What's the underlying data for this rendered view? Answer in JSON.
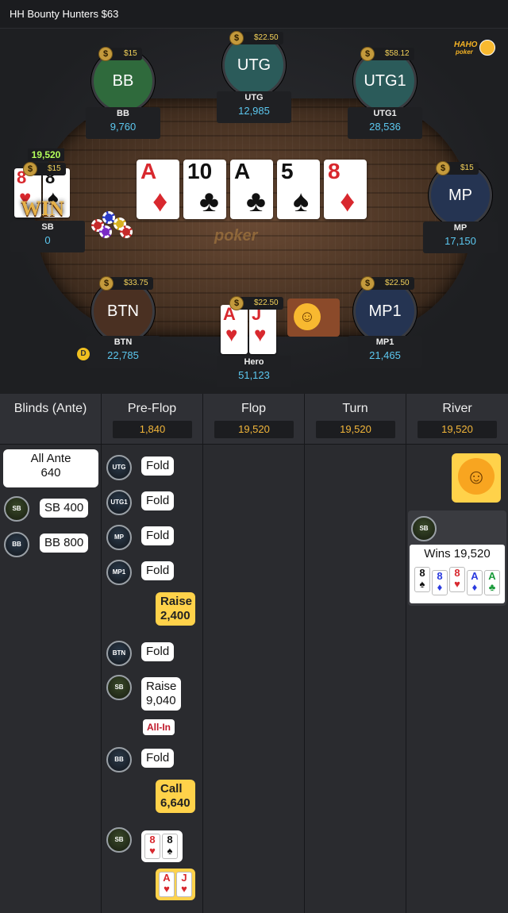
{
  "header": {
    "title": "HH  Bounty Hunters $63"
  },
  "brand": {
    "line1": "HAHO",
    "line2": "poker"
  },
  "table": {
    "watermark": "poker",
    "pot": "19,520",
    "win_label": "WIN"
  },
  "board": [
    {
      "rank": "A",
      "suit": "♦",
      "color": "red"
    },
    {
      "rank": "10",
      "suit": "♣",
      "color": "black"
    },
    {
      "rank": "A",
      "suit": "♣",
      "color": "black"
    },
    {
      "rank": "5",
      "suit": "♠",
      "color": "black"
    },
    {
      "rank": "8",
      "suit": "♦",
      "color": "red"
    }
  ],
  "seats": {
    "bb": {
      "pos": "BB",
      "name": "BB",
      "stack": "9,760",
      "bounty": "$15",
      "color": "#2f6a3c"
    },
    "utg": {
      "pos": "UTG",
      "name": "UTG",
      "stack": "12,985",
      "bounty": "$22.50",
      "color": "#2b5b5a"
    },
    "utg1": {
      "pos": "UTG1",
      "name": "UTG1",
      "stack": "28,536",
      "bounty": "$58.12",
      "color": "#2b5b5a"
    },
    "sb": {
      "name": "SB",
      "stack": "0",
      "bounty": "$15",
      "cards": [
        {
          "rank": "8",
          "suit": "♥",
          "color": "red"
        },
        {
          "rank": "8",
          "suit": "♠",
          "color": "black"
        }
      ]
    },
    "mp": {
      "pos": "MP",
      "name": "MP",
      "stack": "17,150",
      "bounty": "$15",
      "color": "#253452"
    },
    "btn": {
      "pos": "BTN",
      "name": "BTN",
      "stack": "22,785",
      "bounty": "$33.75",
      "color": "#4a3022"
    },
    "mp1": {
      "pos": "MP1",
      "name": "MP1",
      "stack": "21,465",
      "bounty": "$22.50",
      "color": "#253452"
    },
    "hero": {
      "name": "Hero",
      "stack": "51,123",
      "bounty": "$22.50",
      "cards": [
        {
          "rank": "A",
          "suit": "♥",
          "color": "red"
        },
        {
          "rank": "J",
          "suit": "♥",
          "color": "red"
        }
      ]
    }
  },
  "dealer": "D",
  "icons": {
    "bounty": "money-bag-icon",
    "emoji": "laughing-face-icon"
  },
  "history": {
    "columns": [
      {
        "title": "Blinds (Ante)",
        "amount": ""
      },
      {
        "title": "Pre-Flop",
        "amount": "1,840"
      },
      {
        "title": "Flop",
        "amount": "19,520"
      },
      {
        "title": "Turn",
        "amount": "19,520"
      },
      {
        "title": "River",
        "amount": "19,520"
      }
    ],
    "blinds": {
      "ante_label": "All Ante",
      "ante_amount": "640",
      "sb_tag": "SB",
      "sb_text": "SB  400",
      "bb_tag": "BB",
      "bb_text": "BB  800"
    },
    "preflop": [
      {
        "tag": "UTG",
        "text": "Fold"
      },
      {
        "tag": "UTG1",
        "text": "Fold"
      },
      {
        "tag": "MP",
        "text": "Fold"
      },
      {
        "tag": "MP1",
        "text": "Fold"
      },
      {
        "tag": "",
        "text": "Raise",
        "amount": "2,400"
      },
      {
        "tag": "BTN",
        "text": "Fold"
      },
      {
        "tag": "SB",
        "text": "Raise",
        "amount": "9,040",
        "allin": "All-In"
      },
      {
        "tag": "BB",
        "text": "Fold"
      },
      {
        "tag": "",
        "text": "Call",
        "amount": "6,640"
      },
      {
        "tag": "SB"
      }
    ],
    "river": {
      "tag": "SB",
      "wins": "Wins 19,520",
      "cards": [
        {
          "rank": "8",
          "suit": "♠",
          "color": "black"
        },
        {
          "rank": "8",
          "suit": "♦",
          "color": "blue"
        },
        {
          "rank": "8",
          "suit": "♥",
          "color": "red"
        },
        {
          "rank": "A",
          "suit": "♦",
          "color": "blue"
        },
        {
          "rank": "A",
          "suit": "♣",
          "color": "green"
        }
      ]
    },
    "sb_show": [
      {
        "rank": "8",
        "suit": "♥",
        "color": "red"
      },
      {
        "rank": "8",
        "suit": "♠",
        "color": "black"
      }
    ],
    "hero_show": [
      {
        "rank": "A",
        "suit": "♥",
        "color": "red"
      },
      {
        "rank": "J",
        "suit": "♥",
        "color": "red"
      }
    ]
  }
}
